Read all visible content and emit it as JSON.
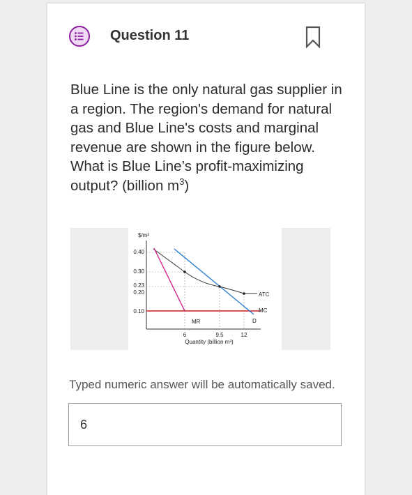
{
  "question": {
    "title": "Question 11",
    "text_main": "Blue Line is the only natural gas supplier in a region. The region's demand for natural gas and Blue Line's costs and marginal revenue are shown in the figure below. What is Blue Line’s profit-maximizing output? (billion m",
    "text_sup": "3",
    "text_end": ")"
  },
  "figure": {
    "y_unit": "$/m³",
    "x_label": "Quantity (billion m³)",
    "y_ticks": [
      "0.40",
      "0.30",
      "0.23",
      "0.20",
      "0.10"
    ],
    "x_ticks": [
      "6",
      "9.5",
      "12"
    ],
    "curve_labels": {
      "atc": "ATC",
      "mc": "MC",
      "mr": "MR",
      "d": "D"
    }
  },
  "chart_data": {
    "type": "line",
    "xlabel": "Quantity (billion m³)",
    "ylabel": "$/m³",
    "ylim": [
      0,
      0.45
    ],
    "series": [
      {
        "name": "D",
        "x": [
          0,
          6,
          9.5,
          12
        ],
        "y": [
          0.5,
          0.3,
          0.23,
          0.1
        ]
      },
      {
        "name": "MR",
        "x": [
          0,
          6
        ],
        "y": [
          0.45,
          0.1
        ]
      },
      {
        "name": "ATC",
        "x": [
          0,
          6,
          9.5,
          12,
          13.5
        ],
        "y": [
          0.4,
          0.3,
          0.23,
          0.2,
          0.2
        ]
      },
      {
        "name": "MC",
        "x": [
          0,
          14
        ],
        "y": [
          0.1,
          0.1
        ]
      }
    ]
  },
  "note": "Typed numeric answer will be automatically saved.",
  "answer": {
    "value": "6"
  },
  "colors": {
    "accent": "#8b1f9f",
    "demand": "#2d7fd1",
    "mr": "#d4268c",
    "mc": "#c91d1d",
    "atc": "#333333"
  }
}
